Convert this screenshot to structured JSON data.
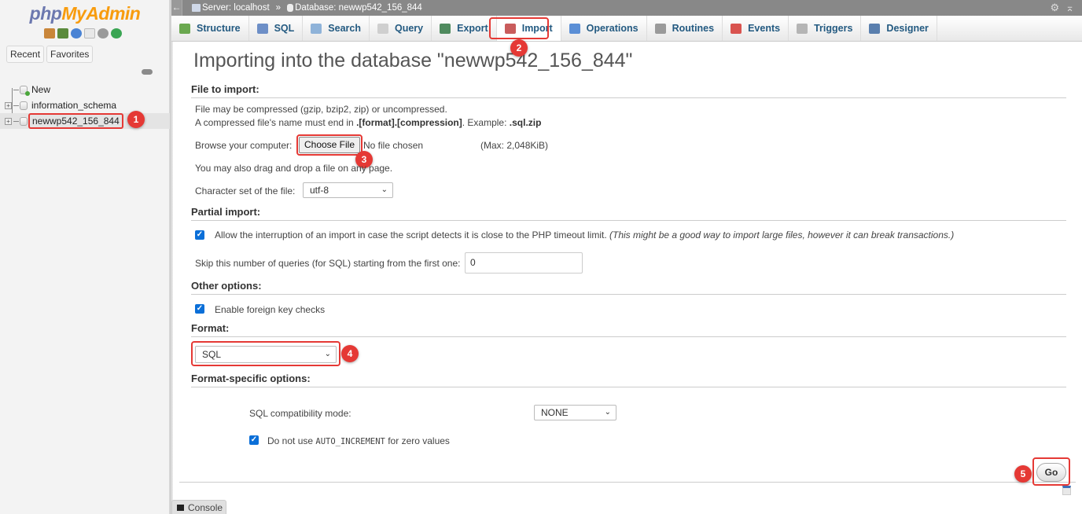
{
  "sidebar": {
    "logo_php": "php",
    "logo_myadmin": "MyAdmin",
    "nav_icons": [
      "home-icon",
      "logout-icon",
      "help-icon",
      "docs-icon",
      "settings-icon",
      "reload-icon"
    ],
    "recent_label": "Recent",
    "favorites_label": "Favorites",
    "tree": {
      "new_label": "New",
      "databases": [
        "information_schema",
        "newwp542_156_844"
      ],
      "selected": "newwp542_156_844"
    }
  },
  "topbar": {
    "server_label": "Server: localhost",
    "separator": "»",
    "database_label": "Database: newwp542_156_844"
  },
  "menu": {
    "tabs": [
      {
        "label": "Structure",
        "icon": "structure-icon",
        "color": "#6aa84f"
      },
      {
        "label": "SQL",
        "icon": "sql-icon",
        "color": "#6d8fc7"
      },
      {
        "label": "Search",
        "icon": "search-icon",
        "color": "#8fb3d9"
      },
      {
        "label": "Query",
        "icon": "query-icon",
        "color": "#cfcfcf"
      },
      {
        "label": "Export",
        "icon": "export-icon",
        "color": "#4f8a5e"
      },
      {
        "label": "Import",
        "icon": "import-icon",
        "color": "#c95c5c"
      },
      {
        "label": "Operations",
        "icon": "wrench-icon",
        "color": "#5b8fd6"
      },
      {
        "label": "Routines",
        "icon": "routines-icon",
        "color": "#9a9a9a"
      },
      {
        "label": "Events",
        "icon": "clock-icon",
        "color": "#d9534f"
      },
      {
        "label": "Triggers",
        "icon": "triggers-icon",
        "color": "#b5b5b5"
      },
      {
        "label": "Designer",
        "icon": "designer-icon",
        "color": "#5a7fae"
      }
    ],
    "active": "Import"
  },
  "page": {
    "title": "Importing into the database \"newwp542_156_844\"",
    "file_section": {
      "heading": "File to import:",
      "line1": "File may be compressed (gzip, bzip2, zip) or uncompressed.",
      "line2_pre": "A compressed file's name must end in ",
      "line2_bold": ".[format].[compression]",
      "line2_mid": ". Example: ",
      "line2_example": ".sql.zip",
      "browse_label": "Browse your computer:",
      "choose_button": "Choose File",
      "no_file": "No file chosen",
      "max_size": "(Max: 2,048KiB)",
      "drag_hint": "You may also drag and drop a file on any page.",
      "charset_label": "Character set of the file:",
      "charset_value": "utf-8"
    },
    "partial_section": {
      "heading": "Partial import:",
      "allow_interrupt_label": "Allow the interruption of an import in case the script detects it is close to the PHP timeout limit.",
      "allow_interrupt_note": "(This might be a good way to import large files, however it can break transactions.)",
      "allow_interrupt_checked": true,
      "skip_label": "Skip this number of queries (for SQL) starting from the first one:",
      "skip_value": "0"
    },
    "other_section": {
      "heading": "Other options:",
      "fk_label": "Enable foreign key checks",
      "fk_checked": true
    },
    "format_section": {
      "heading": "Format:",
      "format_value": "SQL"
    },
    "format_specific": {
      "heading": "Format-specific options:",
      "compat_label": "SQL compatibility mode:",
      "compat_value": "NONE",
      "auto_inc_pre": "Do not use ",
      "auto_inc_code": "AUTO_INCREMENT",
      "auto_inc_post": " for zero values",
      "auto_inc_checked": true
    },
    "go_button": "Go"
  },
  "console_label": "Console",
  "annotations": [
    "1",
    "2",
    "3",
    "4",
    "5"
  ],
  "colors": {
    "annotation": "#e53935",
    "link": "#235a81",
    "checkbox": "#0b6fd8"
  }
}
